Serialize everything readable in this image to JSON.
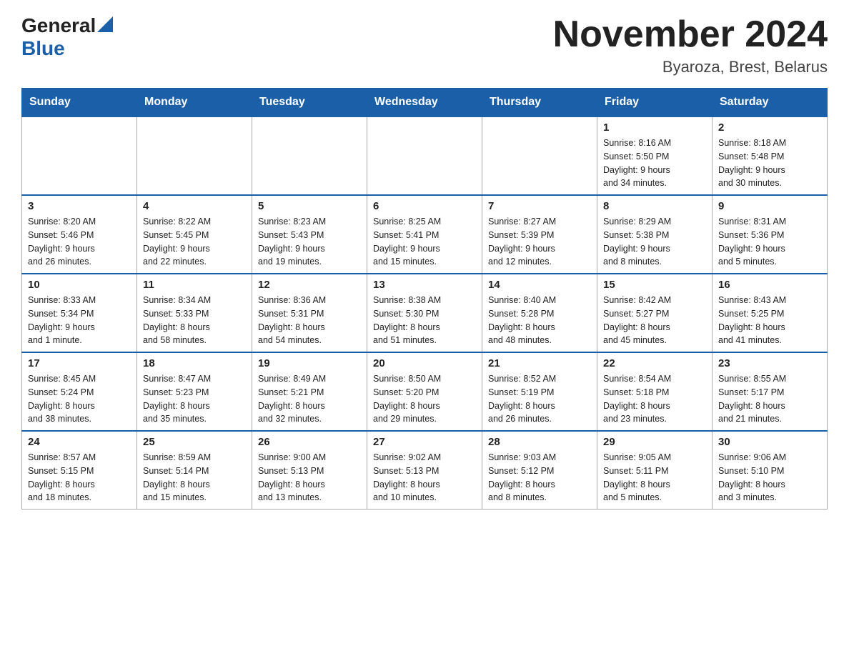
{
  "logo": {
    "general": "General",
    "blue": "Blue"
  },
  "title": "November 2024",
  "subtitle": "Byaroza, Brest, Belarus",
  "weekdays": [
    "Sunday",
    "Monday",
    "Tuesday",
    "Wednesday",
    "Thursday",
    "Friday",
    "Saturday"
  ],
  "weeks": [
    [
      {
        "day": "",
        "info": ""
      },
      {
        "day": "",
        "info": ""
      },
      {
        "day": "",
        "info": ""
      },
      {
        "day": "",
        "info": ""
      },
      {
        "day": "",
        "info": ""
      },
      {
        "day": "1",
        "info": "Sunrise: 8:16 AM\nSunset: 5:50 PM\nDaylight: 9 hours\nand 34 minutes."
      },
      {
        "day": "2",
        "info": "Sunrise: 8:18 AM\nSunset: 5:48 PM\nDaylight: 9 hours\nand 30 minutes."
      }
    ],
    [
      {
        "day": "3",
        "info": "Sunrise: 8:20 AM\nSunset: 5:46 PM\nDaylight: 9 hours\nand 26 minutes."
      },
      {
        "day": "4",
        "info": "Sunrise: 8:22 AM\nSunset: 5:45 PM\nDaylight: 9 hours\nand 22 minutes."
      },
      {
        "day": "5",
        "info": "Sunrise: 8:23 AM\nSunset: 5:43 PM\nDaylight: 9 hours\nand 19 minutes."
      },
      {
        "day": "6",
        "info": "Sunrise: 8:25 AM\nSunset: 5:41 PM\nDaylight: 9 hours\nand 15 minutes."
      },
      {
        "day": "7",
        "info": "Sunrise: 8:27 AM\nSunset: 5:39 PM\nDaylight: 9 hours\nand 12 minutes."
      },
      {
        "day": "8",
        "info": "Sunrise: 8:29 AM\nSunset: 5:38 PM\nDaylight: 9 hours\nand 8 minutes."
      },
      {
        "day": "9",
        "info": "Sunrise: 8:31 AM\nSunset: 5:36 PM\nDaylight: 9 hours\nand 5 minutes."
      }
    ],
    [
      {
        "day": "10",
        "info": "Sunrise: 8:33 AM\nSunset: 5:34 PM\nDaylight: 9 hours\nand 1 minute."
      },
      {
        "day": "11",
        "info": "Sunrise: 8:34 AM\nSunset: 5:33 PM\nDaylight: 8 hours\nand 58 minutes."
      },
      {
        "day": "12",
        "info": "Sunrise: 8:36 AM\nSunset: 5:31 PM\nDaylight: 8 hours\nand 54 minutes."
      },
      {
        "day": "13",
        "info": "Sunrise: 8:38 AM\nSunset: 5:30 PM\nDaylight: 8 hours\nand 51 minutes."
      },
      {
        "day": "14",
        "info": "Sunrise: 8:40 AM\nSunset: 5:28 PM\nDaylight: 8 hours\nand 48 minutes."
      },
      {
        "day": "15",
        "info": "Sunrise: 8:42 AM\nSunset: 5:27 PM\nDaylight: 8 hours\nand 45 minutes."
      },
      {
        "day": "16",
        "info": "Sunrise: 8:43 AM\nSunset: 5:25 PM\nDaylight: 8 hours\nand 41 minutes."
      }
    ],
    [
      {
        "day": "17",
        "info": "Sunrise: 8:45 AM\nSunset: 5:24 PM\nDaylight: 8 hours\nand 38 minutes."
      },
      {
        "day": "18",
        "info": "Sunrise: 8:47 AM\nSunset: 5:23 PM\nDaylight: 8 hours\nand 35 minutes."
      },
      {
        "day": "19",
        "info": "Sunrise: 8:49 AM\nSunset: 5:21 PM\nDaylight: 8 hours\nand 32 minutes."
      },
      {
        "day": "20",
        "info": "Sunrise: 8:50 AM\nSunset: 5:20 PM\nDaylight: 8 hours\nand 29 minutes."
      },
      {
        "day": "21",
        "info": "Sunrise: 8:52 AM\nSunset: 5:19 PM\nDaylight: 8 hours\nand 26 minutes."
      },
      {
        "day": "22",
        "info": "Sunrise: 8:54 AM\nSunset: 5:18 PM\nDaylight: 8 hours\nand 23 minutes."
      },
      {
        "day": "23",
        "info": "Sunrise: 8:55 AM\nSunset: 5:17 PM\nDaylight: 8 hours\nand 21 minutes."
      }
    ],
    [
      {
        "day": "24",
        "info": "Sunrise: 8:57 AM\nSunset: 5:15 PM\nDaylight: 8 hours\nand 18 minutes."
      },
      {
        "day": "25",
        "info": "Sunrise: 8:59 AM\nSunset: 5:14 PM\nDaylight: 8 hours\nand 15 minutes."
      },
      {
        "day": "26",
        "info": "Sunrise: 9:00 AM\nSunset: 5:13 PM\nDaylight: 8 hours\nand 13 minutes."
      },
      {
        "day": "27",
        "info": "Sunrise: 9:02 AM\nSunset: 5:13 PM\nDaylight: 8 hours\nand 10 minutes."
      },
      {
        "day": "28",
        "info": "Sunrise: 9:03 AM\nSunset: 5:12 PM\nDaylight: 8 hours\nand 8 minutes."
      },
      {
        "day": "29",
        "info": "Sunrise: 9:05 AM\nSunset: 5:11 PM\nDaylight: 8 hours\nand 5 minutes."
      },
      {
        "day": "30",
        "info": "Sunrise: 9:06 AM\nSunset: 5:10 PM\nDaylight: 8 hours\nand 3 minutes."
      }
    ]
  ]
}
